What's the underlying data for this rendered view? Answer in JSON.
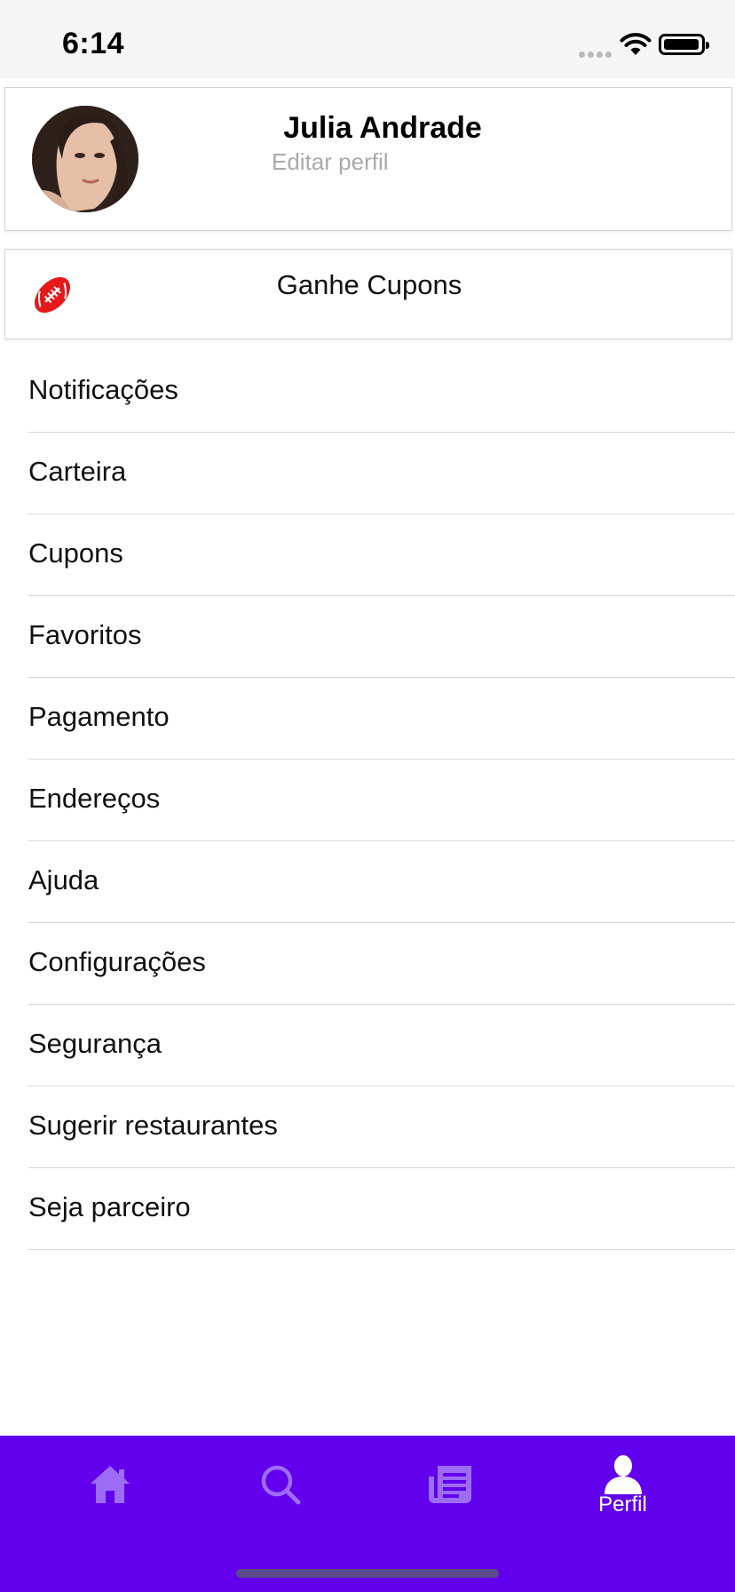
{
  "status_bar": {
    "time": "6:14"
  },
  "profile": {
    "name": "Julia Andrade",
    "edit_label": "Editar perfil"
  },
  "promo": {
    "label": "Ganhe Cupons",
    "icon": "football-icon",
    "icon_color": "#e5191b"
  },
  "menu": {
    "items": [
      {
        "label": "Notificações"
      },
      {
        "label": "Carteira"
      },
      {
        "label": "Cupons"
      },
      {
        "label": "Favoritos"
      },
      {
        "label": "Pagamento"
      },
      {
        "label": "Endereços"
      },
      {
        "label": "Ajuda"
      },
      {
        "label": "Configurações"
      },
      {
        "label": "Segurança"
      },
      {
        "label": "Sugerir restaurantes"
      },
      {
        "label": "Seja parceiro"
      }
    ]
  },
  "tab_bar": {
    "background": "#6200ee",
    "inactive_icon_color": "#9d6cf5",
    "active_color": "#ffffff",
    "tabs": [
      {
        "icon": "home-icon",
        "label": ""
      },
      {
        "icon": "search-icon",
        "label": ""
      },
      {
        "icon": "orders-icon",
        "label": ""
      },
      {
        "icon": "profile-icon",
        "label": "Perfil",
        "active": true
      }
    ]
  }
}
